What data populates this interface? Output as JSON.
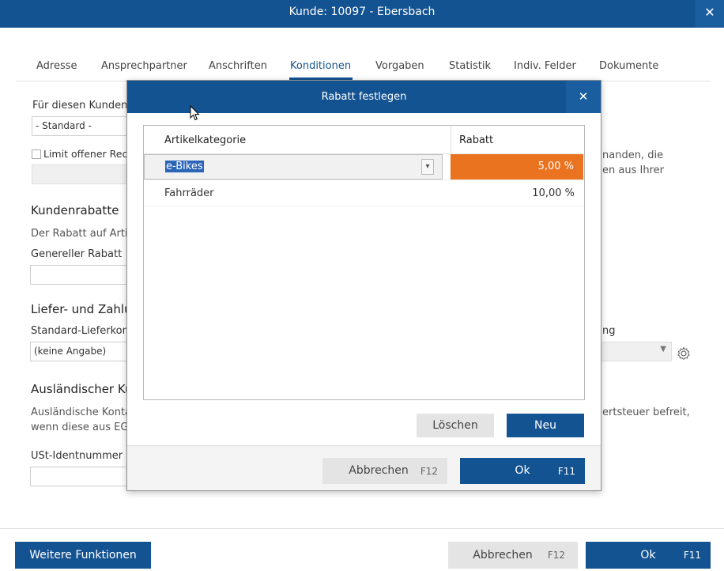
{
  "window": {
    "title": "Kunde: 10097 - Ebersbach",
    "close_glyph": "✕"
  },
  "tabs": [
    "Adresse",
    "Ansprechpartner",
    "Anschriften",
    "Konditionen",
    "Vorgaben",
    "Statistik",
    "Indiv. Felder",
    "Dokumente"
  ],
  "active_tab": "Konditionen",
  "form": {
    "fuer_label": "Für diesen Kunden",
    "standard_value": "- Standard -",
    "limit_label": "Limit offener Rech",
    "right_desc_1": "nanden, die",
    "right_desc_2": "en aus Ihrer",
    "kundenrabatte_heading": "Kundenrabatte",
    "kundenrabatte_desc": "Der Rabatt auf Artik",
    "genereller_label": "Genereller Rabatt",
    "liefer_heading": "Liefer- und Zahlu",
    "standard_liefer_label": "Standard-Lieferkond",
    "keine_angabe": "(keine Angabe)",
    "right_label_ng": "ng",
    "auslaendisch_heading": "Ausländischer Ku",
    "auslaendisch_desc_1": "Ausländische Kontal",
    "auslaendisch_desc_2": "wenn diese aus EG-",
    "right_desc_3": "ertsteuer befreit,",
    "ust_label": "USt-Identnummer"
  },
  "footer": {
    "more_label": "Weitere Funktionen",
    "cancel_label": "Abbrechen",
    "cancel_key": "F12",
    "ok_label": "Ok",
    "ok_key": "F11"
  },
  "dialog": {
    "title": "Rabatt festlegen",
    "close_glyph": "✕",
    "col_category": "Artikelkategorie",
    "col_discount": "Rabatt",
    "rows": [
      {
        "category": "e-Bikes",
        "discount": "5,00 %"
      },
      {
        "category": "Fahrräder",
        "discount": "10,00 %"
      }
    ],
    "delete_label": "Löschen",
    "new_label": "Neu",
    "cancel_label": "Abbrechen",
    "cancel_key": "F12",
    "ok_label": "Ok",
    "ok_key": "F11"
  },
  "colors": {
    "brand": "#145391",
    "selection_orange": "#ea7320",
    "selection_blue": "#2b64b8"
  },
  "icons": [
    "close-icon",
    "chevron-down-icon",
    "gear-icon",
    "mouse-cursor-icon"
  ]
}
